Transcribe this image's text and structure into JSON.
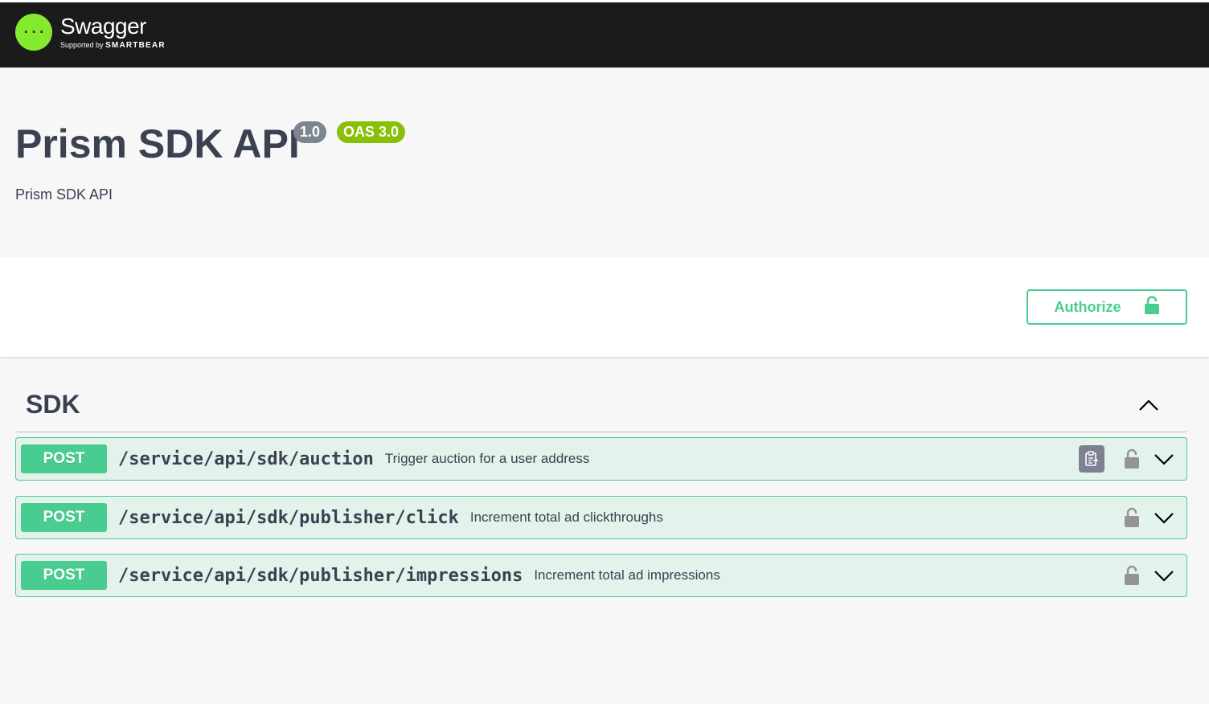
{
  "topbar": {
    "logo_name": "Swagger",
    "logo_sub_prefix": "Supported by",
    "logo_sub_brand": "SMARTBEAR",
    "logo_mark_text": "{···}"
  },
  "info": {
    "title": "Prism SDK API",
    "version": "1.0",
    "oas": "OAS 3.0",
    "description": "Prism SDK API"
  },
  "scheme": {
    "authorize_label": "Authorize"
  },
  "tag": {
    "name": "SDK",
    "expanded": true
  },
  "operations": [
    {
      "method": "POST",
      "path": "/service/api/sdk/auction",
      "summary": "Trigger auction for a user address",
      "show_copy": true
    },
    {
      "method": "POST",
      "path": "/service/api/sdk/publisher/click",
      "summary": "Increment total ad clickthroughs",
      "show_copy": false
    },
    {
      "method": "POST",
      "path": "/service/api/sdk/publisher/impressions",
      "summary": "Increment total ad impressions",
      "show_copy": false
    }
  ],
  "colors": {
    "topbar": "#1b1b1b",
    "logo_green": "#85ea2d",
    "post_green": "#49cc90",
    "version_badge": "#7d8492",
    "oas_badge": "#89bf04",
    "text": "#3b4151"
  },
  "icons": {
    "authorize": "unlocked-lock-icon",
    "operation_lock": "unlocked-lock-icon",
    "operation_toggle": "chevron-down-icon",
    "tag_toggle": "chevron-up-icon",
    "copy": "copy-to-clipboard-icon"
  }
}
